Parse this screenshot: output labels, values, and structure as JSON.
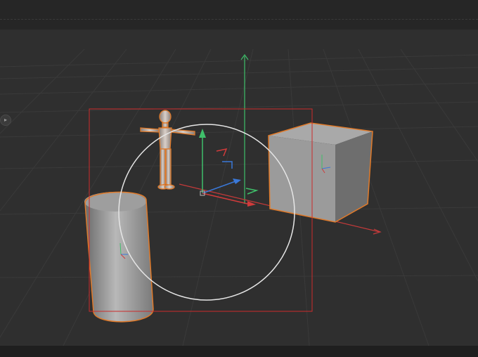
{
  "app": {
    "name": "3D viewport"
  },
  "viewport": {
    "background": "#2f2f2f",
    "grid_color": "#3a3a3a",
    "selection_frame_color": "#cc2b2b",
    "selection_outline_color": "#e07a2a",
    "axis_colors": {
      "x": "#d13b3b",
      "y": "#3fbf6a",
      "z": "#3a78d8"
    }
  },
  "objects": [
    {
      "name": "mannequin",
      "selected": true
    },
    {
      "name": "cube",
      "selected": true
    },
    {
      "name": "cylinder",
      "selected": true
    }
  ],
  "gizmo": {
    "type": "rotate-translate",
    "ring_color": "#e6e6e6"
  },
  "icons": {
    "side_handle": "play-icon"
  }
}
